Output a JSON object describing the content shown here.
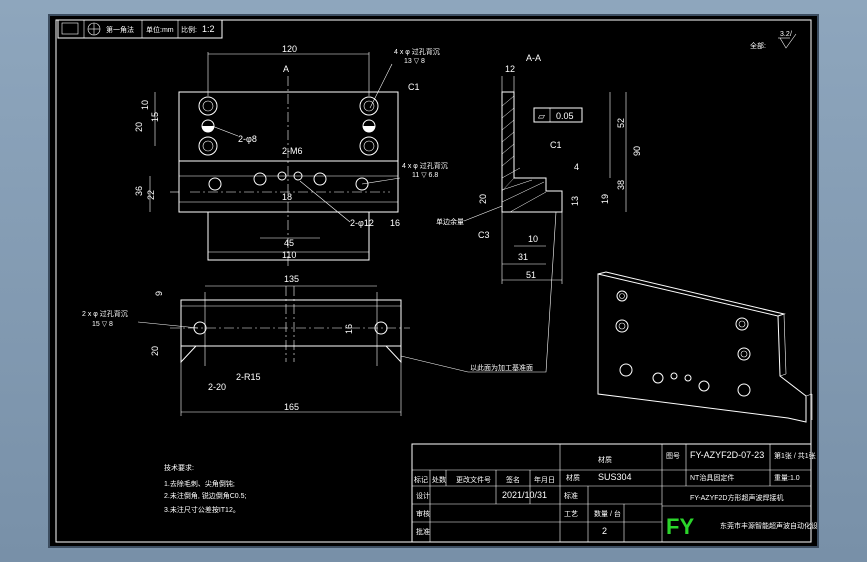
{
  "header_box": {
    "label_a": "第一角法",
    "label_b": "单位:mm",
    "label_c": "比例:",
    "scale": "1:2"
  },
  "roughness": {
    "prefix": "全部:",
    "value": "3.2",
    "check": "/"
  },
  "section_title": "A-A",
  "section_arrow_a": "A",
  "front_view": {
    "dims": {
      "w120": "120",
      "h10": "10",
      "h15": "15",
      "h20": "20",
      "h36": "36",
      "h22": "22",
      "d18": "18",
      "d45": "45",
      "d110": "110",
      "c1": "C1",
      "m6": "2-M6",
      "phi8": "2-φ8",
      "phi12": "2-φ12",
      "slot16": "16"
    },
    "notes": {
      "tap_note": "4 x φ 过孔背沉",
      "tap_depth": "13 ▽ 8",
      "hole_note": "4 x φ 过孔背沉",
      "hole_depth": "11 ▽ 6.8",
      "ref": "A"
    }
  },
  "section_view": {
    "dims": {
      "h90": "90",
      "h52": "52",
      "h38": "38",
      "h19": "19",
      "w12": "12",
      "w4": "4",
      "w10": "10",
      "w31": "31",
      "w51": "51",
      "h20": "20",
      "h13": "13",
      "c1": "C1",
      "c3": "C3"
    },
    "flatness": {
      "symbol": "▱",
      "value": "0.05"
    },
    "note_left": "单边余量"
  },
  "bottom_view": {
    "dims": {
      "w135": "135",
      "w165": "165",
      "h9": "9",
      "h16": "16",
      "h20": "20",
      "r15": "2-R15",
      "a20": "2-20"
    },
    "note": "2 x φ 过孔背沉",
    "note_depth": "15 ▽ 8",
    "leader_note": "以此面为加工基准面"
  },
  "tech_notes": {
    "title": "技术要求:",
    "items": [
      "1.去除毛刺、尖角倒钝;",
      "2.未注倒角, 锐边倒角C0.5;",
      "3.未注尺寸公差按IT12。"
    ]
  },
  "title_block": {
    "material_label": "材质",
    "material": "SUS304",
    "drawing_no_label": "图号",
    "drawing_no": "FY-AZYF2D-07-23",
    "sheet_label": "第1张 / 共1张",
    "part_name": "NT治具固定件",
    "weight_label": "重量:1.0",
    "assembly": "FY-AZYF2D方形超声波焊接机",
    "h_mark": "标记",
    "h_qty": "处数",
    "h_change": "更改文件号",
    "h_sign": "签名",
    "h_date": "年月日",
    "designer_label": "设计",
    "date": "2021/10/31",
    "std_label": "标准",
    "review_label": "审核",
    "process_label": "工艺",
    "approve_label": "批准",
    "qty_label": "数量 / 台",
    "qty": "2",
    "logo": "FY",
    "company": "东莞市丰源智能超声波自动化设备有限公司"
  }
}
